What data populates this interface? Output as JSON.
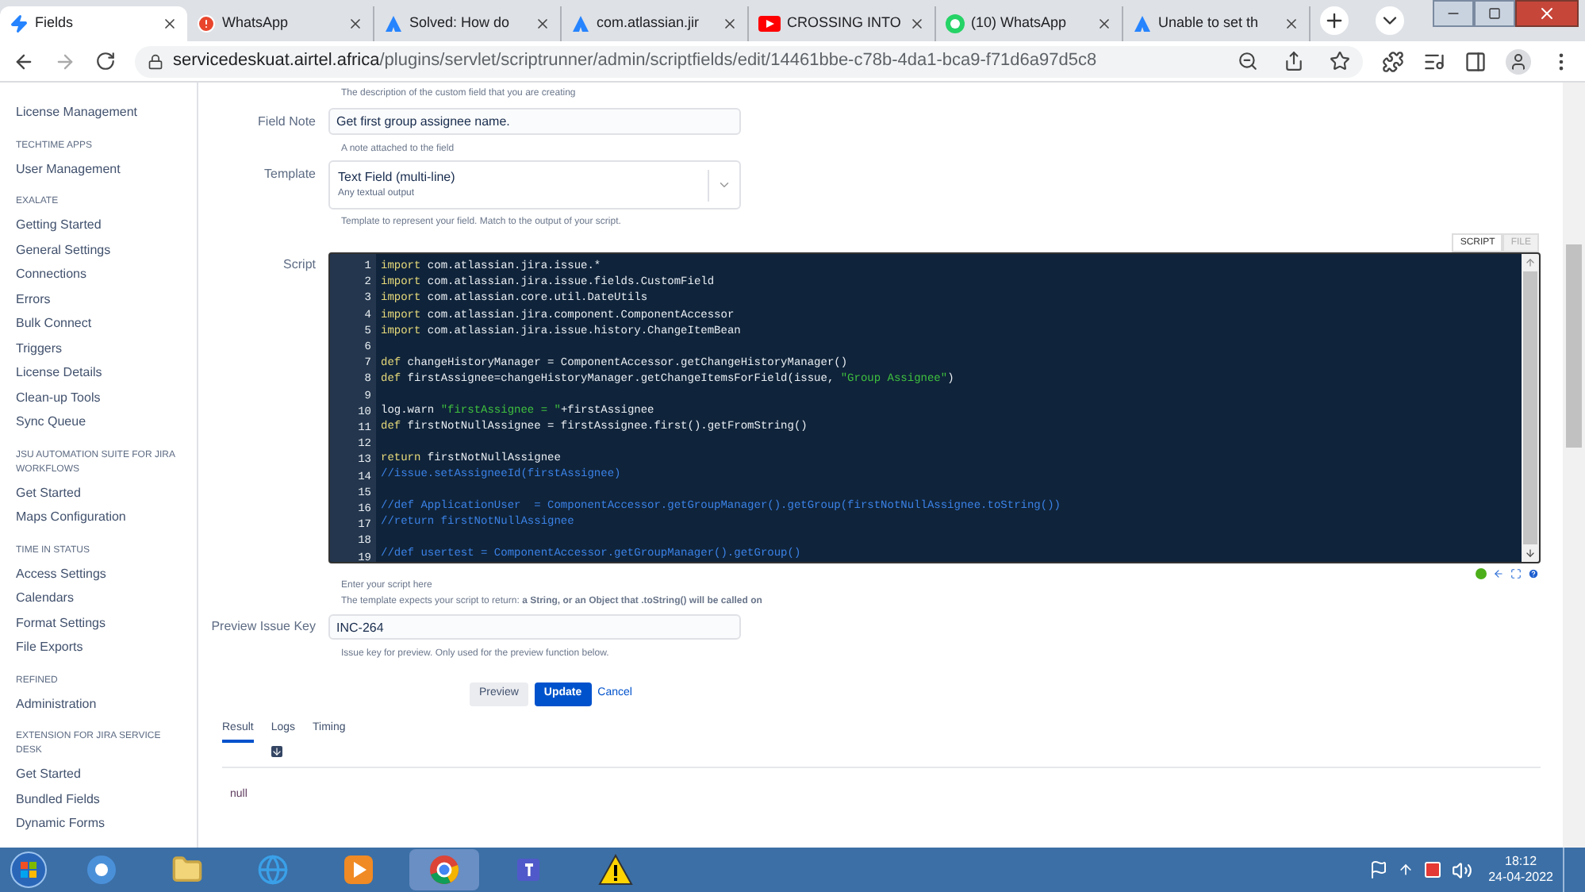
{
  "browser": {
    "tabs": [
      {
        "title": "Fields",
        "kind": "bolt",
        "selected": true
      },
      {
        "title": "WhatsApp",
        "kind": "alert",
        "selected": false
      },
      {
        "title": "Solved: How do",
        "kind": "atlassian",
        "selected": false
      },
      {
        "title": "com.atlassian.jir",
        "kind": "atlassian",
        "selected": false
      },
      {
        "title": "CROSSING INTO",
        "kind": "youtube",
        "selected": false
      },
      {
        "title": "(10) WhatsApp",
        "kind": "whatsapp",
        "selected": false
      },
      {
        "title": "Unable to set th",
        "kind": "atlassian",
        "selected": false
      }
    ],
    "url_host": "servicedeskuat.airtel.africa",
    "url_path": "/plugins/servlet/scriptrunner/admin/scriptfields/edit/14461bbe-c78b-4da1-bca9-f71d6a97d5c8"
  },
  "sidebar": {
    "sections": [
      {
        "items": [
          "License Management"
        ]
      },
      {
        "heading": "TECHTIME APPS",
        "items": [
          "User Management"
        ]
      },
      {
        "heading": "EXALATE",
        "items": [
          "Getting Started",
          "General Settings",
          "Connections",
          "Errors",
          "Bulk Connect",
          "Triggers",
          "License Details",
          "Clean-up Tools",
          "Sync Queue"
        ]
      },
      {
        "heading": "JSU AUTOMATION SUITE FOR JIRA WORKFLOWS",
        "items": [
          "Get Started",
          "Maps Configuration"
        ]
      },
      {
        "heading": "TIME IN STATUS",
        "items": [
          "Access Settings",
          "Calendars",
          "Format Settings",
          "File Exports"
        ]
      },
      {
        "heading": "REFINED",
        "items": [
          "Administration"
        ]
      },
      {
        "heading": "EXTENSION FOR JIRA SERVICE DESK",
        "items": [
          "Get Started",
          "Bundled Fields",
          "Dynamic Forms"
        ]
      }
    ]
  },
  "form": {
    "description_hint": "The description of the custom field that you are creating",
    "field_note": {
      "label": "Field Note",
      "value": "Get first group assignee name.",
      "hint": "A note attached to the field"
    },
    "template": {
      "label": "Template",
      "value": "Text Field (multi-line)",
      "sub": "Any textual output",
      "hint": "Template to represent your field. Match to the output of your script."
    },
    "script": {
      "label": "Script",
      "modes": [
        {
          "label": "SCRIPT",
          "selected": true
        },
        {
          "label": "FILE",
          "selected": false
        }
      ],
      "lines": [
        {
          "number": "1",
          "segments": [
            {
              "kind": "kw",
              "text": "import"
            },
            {
              "kind": "txt",
              "text": " com.atlassian.jira.issue.*"
            }
          ]
        },
        {
          "number": "2",
          "segments": [
            {
              "kind": "kw",
              "text": "import"
            },
            {
              "kind": "txt",
              "text": " com.atlassian.jira.issue.fields.CustomField"
            }
          ]
        },
        {
          "number": "3",
          "segments": [
            {
              "kind": "kw",
              "text": "import"
            },
            {
              "kind": "txt",
              "text": " com.atlassian.core.util.DateUtils"
            }
          ]
        },
        {
          "number": "4",
          "segments": [
            {
              "kind": "kw",
              "text": "import"
            },
            {
              "kind": "txt",
              "text": " com.atlassian.jira.component.ComponentAccessor"
            }
          ]
        },
        {
          "number": "5",
          "segments": [
            {
              "kind": "kw",
              "text": "import"
            },
            {
              "kind": "txt",
              "text": " com.atlassian.jira.issue.history.ChangeItemBean"
            }
          ]
        },
        {
          "number": "6"
        },
        {
          "number": "7",
          "segments": [
            {
              "kind": "kw",
              "text": "def"
            },
            {
              "kind": "txt",
              "text": " changeHistoryManager = ComponentAccessor.getChangeHistoryManager()"
            }
          ]
        },
        {
          "number": "8",
          "segments": [
            {
              "kind": "kw",
              "text": "def"
            },
            {
              "kind": "txt",
              "text": " firstAssignee=changeHistoryManager.getChangeItemsForField(issue, "
            },
            {
              "kind": "str",
              "text": "\"Group Assignee\""
            },
            {
              "kind": "txt",
              "text": ")"
            }
          ]
        },
        {
          "number": "9"
        },
        {
          "number": "10",
          "segments": [
            {
              "kind": "txt",
              "text": "log.warn "
            },
            {
              "kind": "str",
              "text": "\"firstAssignee = \""
            },
            {
              "kind": "txt",
              "text": "+firstAssignee"
            }
          ]
        },
        {
          "number": "11",
          "segments": [
            {
              "kind": "kw",
              "text": "def"
            },
            {
              "kind": "txt",
              "text": " firstNotNullAssignee = firstAssignee.first().getFromString()"
            }
          ]
        },
        {
          "number": "12"
        },
        {
          "number": "13",
          "segments": [
            {
              "kind": "kw",
              "text": "return"
            },
            {
              "kind": "txt",
              "text": " firstNotNullAssignee"
            }
          ]
        },
        {
          "number": "14",
          "segments": [
            {
              "kind": "cmt",
              "text": "//issue.setAssigneeId(firstAssignee)"
            }
          ]
        },
        {
          "number": "15"
        },
        {
          "number": "16",
          "segments": [
            {
              "kind": "cmt",
              "text": "//def ApplicationUser  = ComponentAccessor.getGroupManager().getGroup(firstNotNullAssignee.toString())"
            }
          ]
        },
        {
          "number": "17",
          "segments": [
            {
              "kind": "cmt",
              "text": "//return firstNotNullAssignee"
            }
          ]
        },
        {
          "number": "18"
        },
        {
          "number": "19",
          "segments": [
            {
              "kind": "cmt",
              "text": "//def usertest = ComponentAccessor.getGroupManager().getGroup()"
            }
          ]
        }
      ],
      "hint": "Enter your script here",
      "expects": "The template expects your script to return: **a String, or an Object that .toString() will be called on**"
    },
    "preview_key": {
      "label": "Preview Issue Key",
      "value": "INC-264",
      "hint": "Issue key for preview. Only used for the preview function below."
    },
    "buttons": [
      "Preview",
      "Update"
    ],
    "cancel": "Cancel"
  },
  "results": {
    "tabs": [
      {
        "label": "Result",
        "selected": true
      },
      {
        "label": "Logs",
        "selected": false
      },
      {
        "label": "Timing",
        "selected": false
      }
    ],
    "output": "null"
  },
  "taskbar": {
    "apps": [
      {
        "kind": "chromium"
      },
      {
        "kind": "folder"
      },
      {
        "kind": "ie"
      },
      {
        "kind": "media"
      },
      {
        "kind": "chrome"
      },
      {
        "kind": "teams"
      },
      {
        "kind": "warning"
      }
    ],
    "time": "18:12",
    "date": "24-04-2022"
  }
}
